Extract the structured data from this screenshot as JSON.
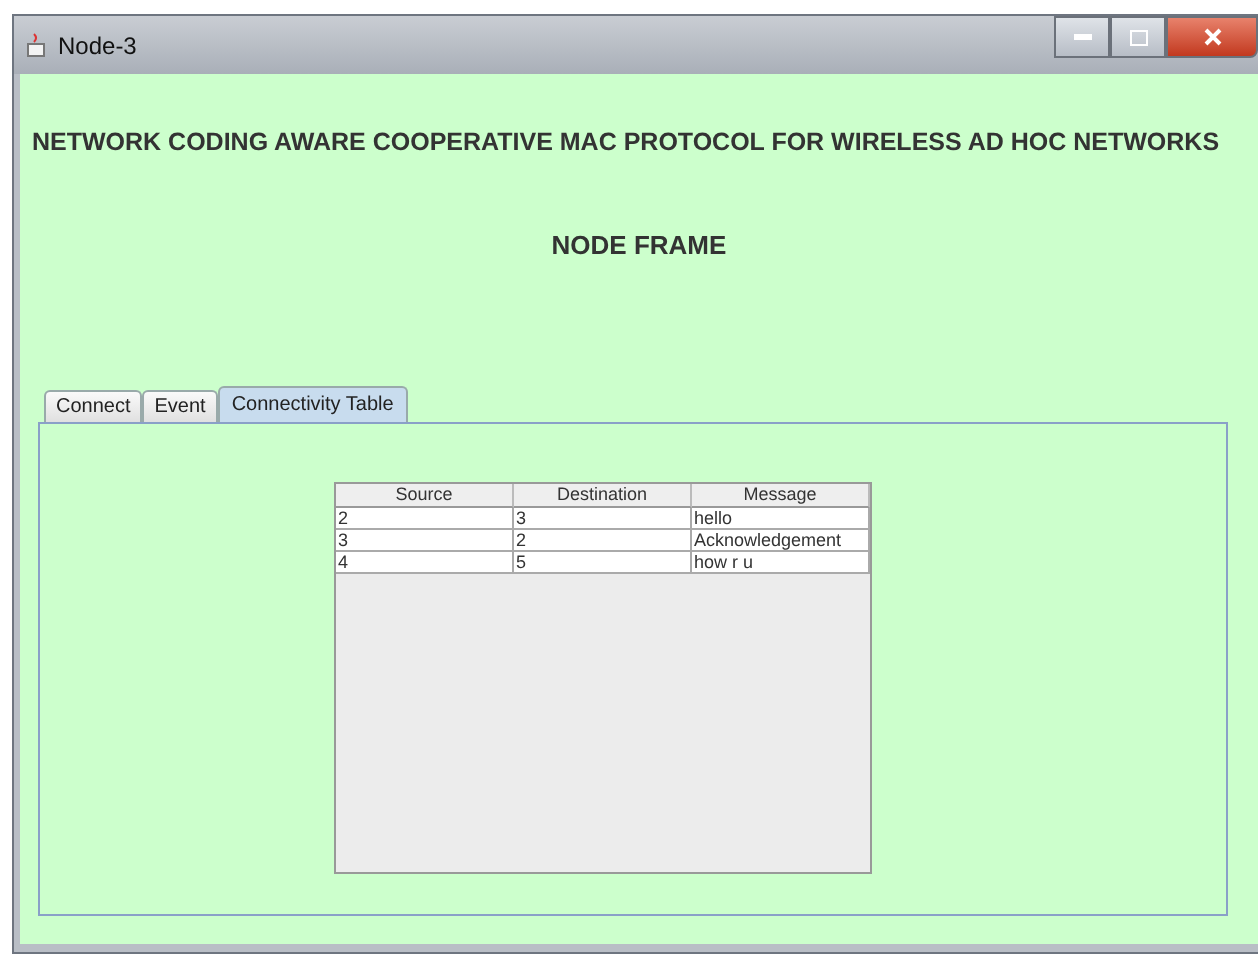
{
  "window": {
    "title": "Node-3"
  },
  "heading": "NETWORK CODING AWARE COOPERATIVE MAC PROTOCOL FOR WIRELESS AD HOC NETWORKS",
  "subheading": "NODE FRAME",
  "tabs": [
    {
      "label": "Connect",
      "selected": false
    },
    {
      "label": "Event",
      "selected": false
    },
    {
      "label": "Connectivity Table",
      "selected": true
    }
  ],
  "table": {
    "columns": [
      "Source",
      "Destination",
      "Message"
    ],
    "rows": [
      [
        "2",
        "3",
        "hello"
      ],
      [
        "3",
        "2",
        "Acknowledgement"
      ],
      [
        "4",
        "5",
        "how r u"
      ]
    ]
  }
}
